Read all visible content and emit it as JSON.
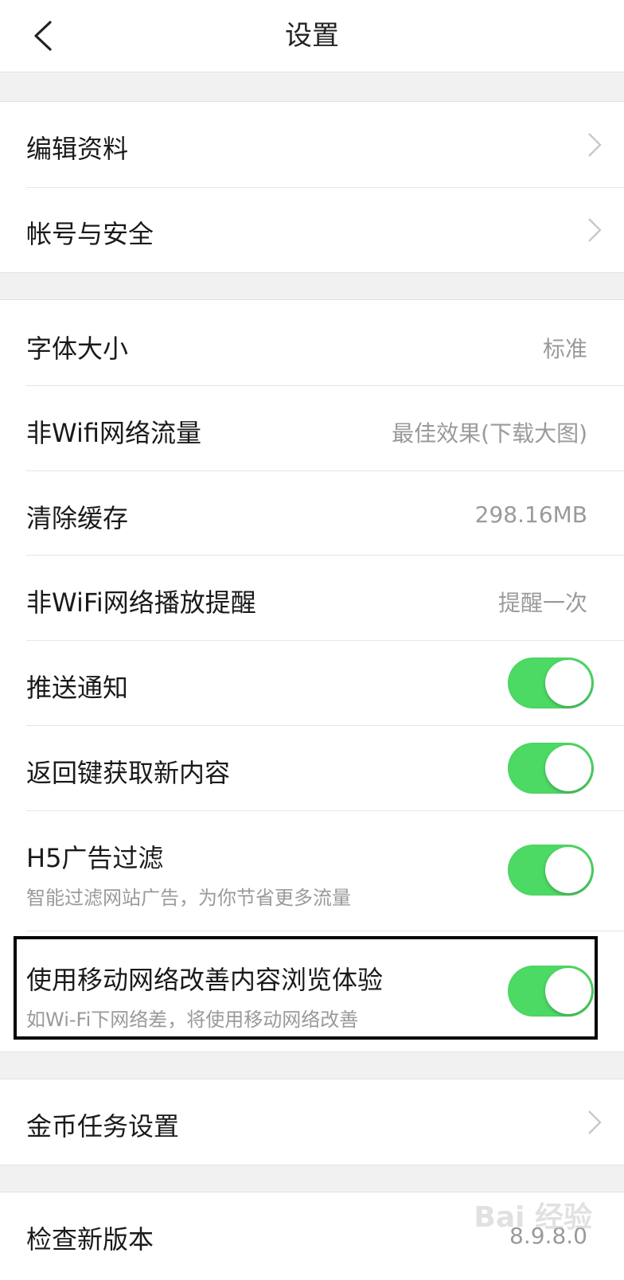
{
  "header": {
    "title": "设置"
  },
  "group1": [
    {
      "label": "编辑资料"
    },
    {
      "label": "帐号与安全"
    }
  ],
  "group2": {
    "font_size": {
      "label": "字体大小",
      "value": "标准"
    },
    "non_wifi_traffic": {
      "label": "非Wifi网络流量",
      "value": "最佳效果(下载大图)"
    },
    "clear_cache": {
      "label": "清除缓存",
      "value": "298.16MB"
    },
    "non_wifi_play": {
      "label": "非WiFi网络播放提醒",
      "value": "提醒一次"
    },
    "push": {
      "label": "推送通知",
      "enabled": true
    },
    "back_refresh": {
      "label": "返回键获取新内容",
      "enabled": true
    },
    "h5_filter": {
      "label": "H5广告过滤",
      "sub": "智能过滤网站广告，为你节省更多流量",
      "enabled": true
    },
    "mobile_assist": {
      "label": "使用移动网络改善内容浏览体验",
      "sub": "如Wi-Fi下网络差，将使用移动网络改善",
      "enabled": true
    }
  },
  "group3": {
    "coin_task": {
      "label": "金币任务设置"
    }
  },
  "group4": {
    "check_update": {
      "label": "检查新版本",
      "value": "8.9.8.0"
    }
  },
  "watermark": {
    "text": "Bai 经验"
  },
  "colors": {
    "toggle_on": "#4cd964",
    "background": "#f1f1f1"
  }
}
